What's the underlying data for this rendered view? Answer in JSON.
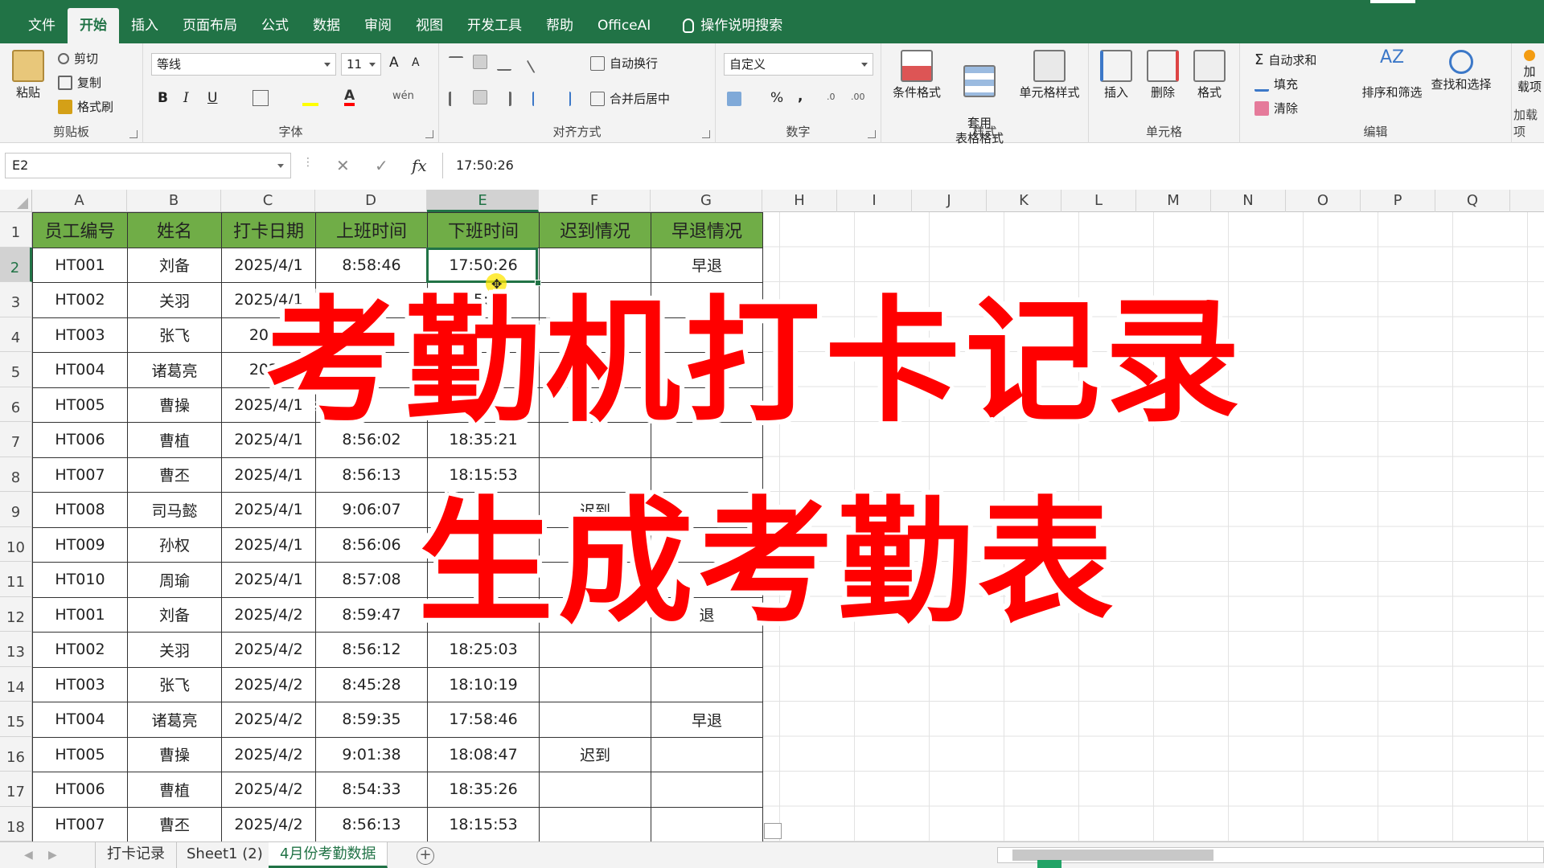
{
  "ribbon_tabs": [
    "文件",
    "开始",
    "插入",
    "页面布局",
    "公式",
    "数据",
    "审阅",
    "视图",
    "开发工具",
    "帮助",
    "OfficeAI"
  ],
  "active_tab": "开始",
  "tell_me": "操作说明搜索",
  "ribbon": {
    "clipboard": {
      "paste": "粘贴",
      "cut": "剪切",
      "copy": "复制",
      "format_painter": "格式刷",
      "label": "剪贴板"
    },
    "font": {
      "name": "等线",
      "size": "11",
      "grow": "A",
      "shrink": "A",
      "bold": "B",
      "italic": "I",
      "underline": "U",
      "wen": "wén",
      "label": "字体"
    },
    "align": {
      "wrap": "自动换行",
      "merge": "合并后居中",
      "label": "对齐方式"
    },
    "number": {
      "format": "自定义",
      "percent": "%",
      "comma": ",",
      "label": "数字"
    },
    "styles": {
      "cond": "条件格式",
      "table": "套用\n表格格式",
      "cell": "单元格样式",
      "label": "样式"
    },
    "cells": {
      "insert": "插入",
      "delete": "删除",
      "format": "格式",
      "label": "单元格"
    },
    "editing": {
      "autosum": "自动求和",
      "fill": "填充",
      "clear": "清除",
      "sort": "排序和筛选",
      "find": "查找和选择",
      "label": "编辑"
    },
    "addins": {
      "add": "加",
      "label": "载项",
      "group": "加载项"
    }
  },
  "formula_bar": {
    "name_box": "E2",
    "cancel": "✕",
    "enter": "✓",
    "fx": "fx",
    "content": "17:50:26"
  },
  "columns": [
    "A",
    "B",
    "C",
    "D",
    "E",
    "F",
    "G",
    "H",
    "I",
    "J",
    "K",
    "L",
    "M",
    "N",
    "O",
    "P",
    "Q"
  ],
  "rows": [
    "1",
    "2",
    "3",
    "4",
    "5",
    "6",
    "7",
    "8",
    "9",
    "10",
    "11",
    "12",
    "13",
    "14",
    "15",
    "16",
    "17",
    "18"
  ],
  "selected": {
    "col": "E",
    "row": "2"
  },
  "table": {
    "headers": [
      "员工编号",
      "姓名",
      "打卡日期",
      "上班时间",
      "下班时间",
      "迟到情况",
      "早退情况"
    ],
    "rows": [
      [
        "HT001",
        "刘备",
        "2025/4/1",
        "8:58:46",
        "17:50:26",
        "",
        "早退"
      ],
      [
        "HT002",
        "关羽",
        "2025/4/1",
        "",
        ":55:17",
        "",
        ""
      ],
      [
        "HT003",
        "张飞",
        "2025",
        "",
        "",
        "",
        ""
      ],
      [
        "HT004",
        "诸葛亮",
        "2025",
        "",
        "",
        "",
        ""
      ],
      [
        "HT005",
        "曹操",
        "2025/4/1",
        "",
        "",
        "",
        ""
      ],
      [
        "HT006",
        "曹植",
        "2025/4/1",
        "8:56:02",
        "18:35:21",
        "",
        ""
      ],
      [
        "HT007",
        "曹丕",
        "2025/4/1",
        "8:56:13",
        "18:15:53",
        "",
        ""
      ],
      [
        "HT008",
        "司马懿",
        "2025/4/1",
        "9:06:07",
        "",
        "迟到",
        ""
      ],
      [
        "HT009",
        "孙权",
        "2025/4/1",
        "8:56:06",
        "",
        "",
        ""
      ],
      [
        "HT010",
        "周瑜",
        "2025/4/1",
        "8:57:08",
        "",
        "",
        ""
      ],
      [
        "HT001",
        "刘备",
        "2025/4/2",
        "8:59:47",
        "",
        "",
        "退"
      ],
      [
        "HT002",
        "关羽",
        "2025/4/2",
        "8:56:12",
        "18:25:03",
        "",
        ""
      ],
      [
        "HT003",
        "张飞",
        "2025/4/2",
        "8:45:28",
        "18:10:19",
        "",
        ""
      ],
      [
        "HT004",
        "诸葛亮",
        "2025/4/2",
        "8:59:35",
        "17:58:46",
        "",
        "早退"
      ],
      [
        "HT005",
        "曹操",
        "2025/4/2",
        "9:01:38",
        "18:08:47",
        "迟到",
        ""
      ],
      [
        "HT006",
        "曹植",
        "2025/4/2",
        "8:54:33",
        "18:35:26",
        "",
        ""
      ],
      [
        "HT007",
        "曹丕",
        "2025/4/2",
        "8:56:13",
        "18:15:53",
        "",
        ""
      ]
    ]
  },
  "overlay": {
    "line1": "考勤机打卡记录",
    "line2": "生成考勤表"
  },
  "sheet_tabs": [
    "打卡记录",
    "Sheet1 (2)",
    "4月份考勤数据"
  ],
  "active_sheet": "4月份考勤数据",
  "colors": {
    "excel_green": "#217346",
    "header_fill": "#70ad47",
    "overlay_red": "#ff0000"
  }
}
